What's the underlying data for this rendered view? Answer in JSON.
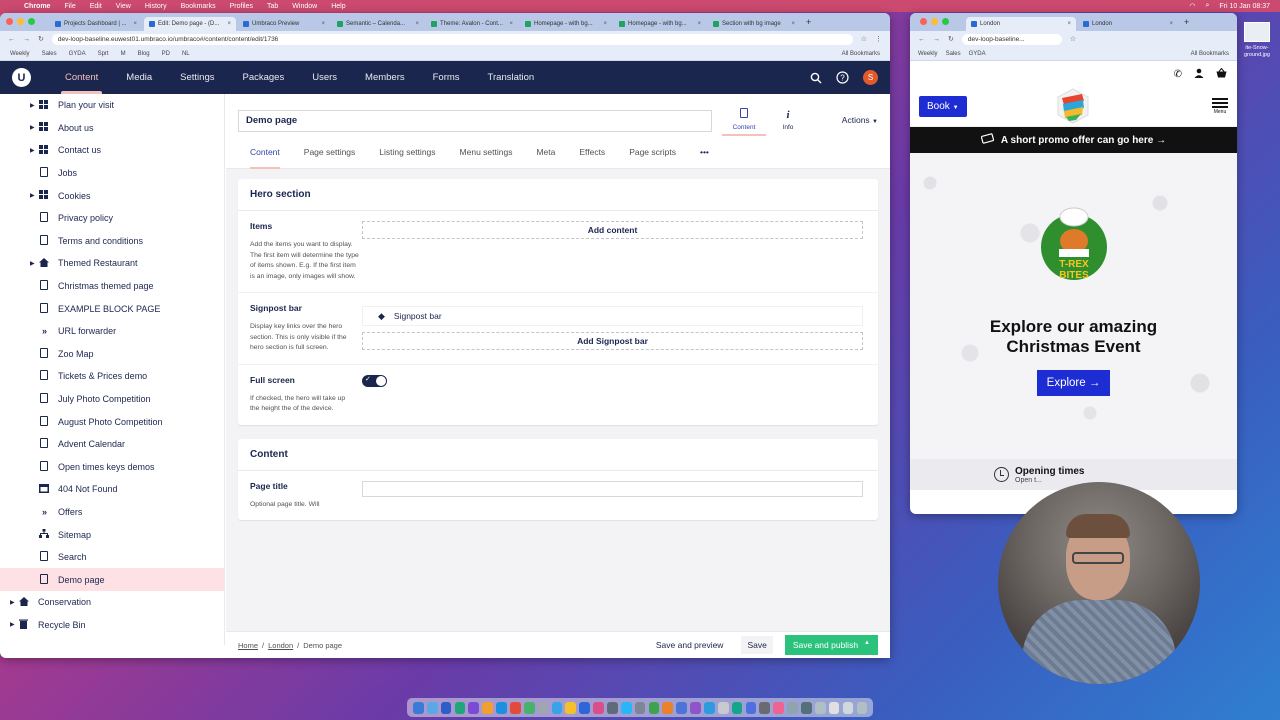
{
  "mac_menubar": {
    "app": "Chrome",
    "items": [
      "File",
      "Edit",
      "View",
      "History",
      "Bookmarks",
      "Profiles",
      "Tab",
      "Window",
      "Help"
    ],
    "clock": "Fri 10 Jan  08:37"
  },
  "left_browser": {
    "tabs": [
      {
        "label": "Projects Dashboard | ...",
        "active": false
      },
      {
        "label": "Edit: Demo page - (D...",
        "active": true
      },
      {
        "label": "Umbraco Preview",
        "active": false
      },
      {
        "label": "Semantic – Calenda...",
        "active": false
      },
      {
        "label": "Theme: Avalon - Cont...",
        "active": false
      },
      {
        "label": "Homepage - with bg...",
        "active": false
      },
      {
        "label": "Homepage - with bg...",
        "active": false
      },
      {
        "label": "Section with bg image",
        "active": false
      }
    ],
    "url": "dev-loop-baseline.euwest01.umbraco.io/umbraco#/content/content/edit/1736",
    "bookmarks": [
      "Weekly",
      "Sales",
      "GYDA",
      "Sprt",
      "M",
      "Blog",
      "PD",
      "NL"
    ],
    "all_bookmarks": "All Bookmarks"
  },
  "umbraco": {
    "logo": "U",
    "sections": [
      {
        "label": "Content",
        "active": true
      },
      {
        "label": "Media",
        "active": false
      },
      {
        "label": "Settings",
        "active": false
      },
      {
        "label": "Packages",
        "active": false
      },
      {
        "label": "Users",
        "active": false
      },
      {
        "label": "Members",
        "active": false
      },
      {
        "label": "Forms",
        "active": false
      },
      {
        "label": "Translation",
        "active": false
      }
    ],
    "avatar_initial": "S"
  },
  "tree": {
    "items": [
      {
        "label": "Plan your visit",
        "icon": "grid-icon",
        "caret": true,
        "indent": 1
      },
      {
        "label": "About us",
        "icon": "grid-icon",
        "caret": true,
        "indent": 1
      },
      {
        "label": "Contact us",
        "icon": "grid-icon",
        "caret": true,
        "indent": 1
      },
      {
        "label": "Jobs",
        "icon": "document-icon",
        "caret": false,
        "indent": 1
      },
      {
        "label": "Cookies",
        "icon": "grid-icon",
        "caret": true,
        "indent": 1
      },
      {
        "label": "Privacy policy",
        "icon": "document-icon",
        "caret": false,
        "indent": 1
      },
      {
        "label": "Terms and conditions",
        "icon": "document-icon",
        "caret": false,
        "indent": 1
      },
      {
        "label": "Themed Restaurant",
        "icon": "home-icon",
        "caret": true,
        "indent": 1
      },
      {
        "label": "Christmas themed page",
        "icon": "document-icon",
        "caret": false,
        "indent": 1
      },
      {
        "label": "EXAMPLE BLOCK PAGE",
        "icon": "document-icon",
        "caret": false,
        "indent": 1
      },
      {
        "label": "URL forwarder",
        "icon": "double-chevron-icon",
        "caret": false,
        "indent": 1
      },
      {
        "label": "Zoo Map",
        "icon": "document-icon",
        "caret": false,
        "indent": 1
      },
      {
        "label": "Tickets & Prices demo",
        "icon": "document-icon",
        "caret": false,
        "indent": 1
      },
      {
        "label": "July Photo Competition",
        "icon": "document-icon",
        "caret": false,
        "indent": 1
      },
      {
        "label": "August Photo Competition",
        "icon": "document-icon",
        "caret": false,
        "indent": 1
      },
      {
        "label": "Advent Calendar",
        "icon": "document-icon",
        "caret": false,
        "indent": 1
      },
      {
        "label": "Open times keys demos",
        "icon": "document-icon",
        "caret": false,
        "indent": 1
      },
      {
        "label": "404 Not Found",
        "icon": "window-icon",
        "caret": false,
        "indent": 1
      },
      {
        "label": "Offers",
        "icon": "double-chevron-icon",
        "caret": false,
        "indent": 1
      },
      {
        "label": "Sitemap",
        "icon": "sitemap-icon",
        "caret": false,
        "indent": 1
      },
      {
        "label": "Search",
        "icon": "document-icon",
        "caret": false,
        "indent": 1
      },
      {
        "label": "Demo page",
        "icon": "document-icon",
        "caret": false,
        "indent": 1,
        "active": true
      },
      {
        "label": "Conservation",
        "icon": "home-icon",
        "caret": true,
        "indent": 0
      },
      {
        "label": "Recycle Bin",
        "icon": "trash-icon",
        "caret": true,
        "indent": 0
      }
    ]
  },
  "editor": {
    "name": "Demo page",
    "apps": [
      {
        "label": "Content",
        "icon": "document-icon",
        "active": true
      },
      {
        "label": "Info",
        "icon": "info-icon",
        "active": false
      }
    ],
    "actions_label": "Actions",
    "tabs": [
      {
        "label": "Content",
        "active": true
      },
      {
        "label": "Page settings",
        "active": false
      },
      {
        "label": "Listing settings",
        "active": false
      },
      {
        "label": "Menu settings",
        "active": false
      },
      {
        "label": "Meta",
        "active": false
      },
      {
        "label": "Effects",
        "active": false
      },
      {
        "label": "Page scripts",
        "active": false
      }
    ],
    "more_label": "•••",
    "hero": {
      "title": "Hero section",
      "items_label": "Items",
      "items_desc": "Add the items you want to display. The first item will determine the type of items shown. E.g. If the first item is an image, only images will show.",
      "add_content": "Add content",
      "signpost_label": "Signpost bar",
      "signpost_desc": "Display key links over the hero section. This is only visible if the hero section is full screen.",
      "signpost_block": "Signpost bar",
      "add_signpost": "Add Signpost bar",
      "fullscreen_label": "Full screen",
      "fullscreen_desc": "If checked, the hero will take up the height the of the device.",
      "fullscreen_on": true
    },
    "content": {
      "title": "Content",
      "page_title_label": "Page title",
      "page_title_desc": "Optional page title. Will"
    }
  },
  "footer": {
    "breadcrumb": [
      "Home",
      "London",
      "Demo page"
    ],
    "save_preview": "Save and preview",
    "save": "Save",
    "save_publish": "Save and publish"
  },
  "right_browser": {
    "tabs": [
      {
        "label": "London",
        "active": true
      },
      {
        "label": "London",
        "active": false
      }
    ],
    "url": "dev-loop-baseline...",
    "bookmarks": [
      "Weekly",
      "Sales",
      "GYDA"
    ],
    "all_bookmarks": "All Bookmarks",
    "site": {
      "book_label": "Book",
      "menu_label": "Menu",
      "promo": "A short promo offer can go here →",
      "logo_line1": "T-REX",
      "logo_line2": "BITES",
      "hero_title": "Explore our amazing Christmas Event",
      "explore_label": "Explore →",
      "opening_title": "Opening times",
      "opening_sub": "Open t..."
    }
  },
  "desktop": {
    "file_name": "ite-Snow-ground.jpg"
  }
}
